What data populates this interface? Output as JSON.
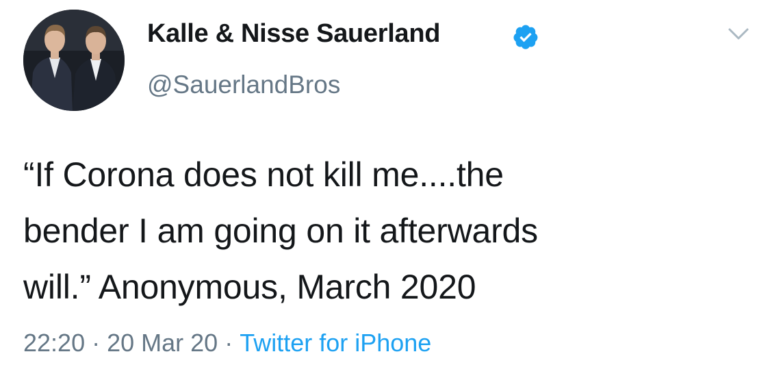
{
  "author": {
    "display_name": "Kalle & Nisse Sauerland",
    "handle": "@SauerlandBros",
    "verified": true,
    "avatar_icon": "avatar-photo-two-men-in-suits"
  },
  "tweet": {
    "lines": [
      "“If Corona does not kill me....the",
      "bender I am going on it afterwards",
      "will.” Anonymous, March 2020"
    ]
  },
  "meta": {
    "time": "22:20",
    "separator": "·",
    "date": "20 Mar 20",
    "source": "Twitter for iPhone"
  },
  "icons": {
    "verified": "verified-badge-icon",
    "menu": "chevron-down-icon"
  },
  "colors": {
    "text": "#14171a",
    "secondary": "#657786",
    "link": "#1da1f2",
    "verified": "#1da1f2",
    "background": "#ffffff"
  }
}
